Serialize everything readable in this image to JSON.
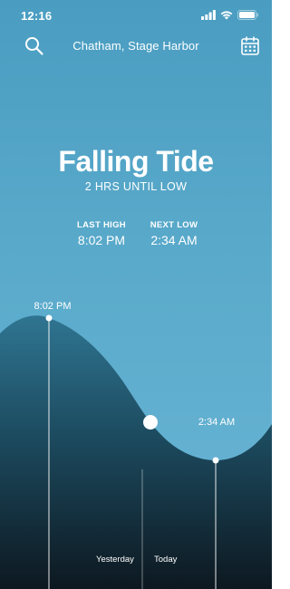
{
  "status_bar": {
    "time": "12:16",
    "icons": [
      "signal-icon",
      "wifi-icon",
      "battery-icon"
    ]
  },
  "header": {
    "location": "Chatham, Stage Harbor",
    "left_icon": "search-icon",
    "right_icon": "calendar-icon"
  },
  "tide": {
    "state": "Falling Tide",
    "countdown": "2 HRS UNTIL LOW",
    "last_high_label": "LAST HIGH",
    "last_high_time": "8:02 PM",
    "next_low_label": "NEXT LOW",
    "next_low_time": "2:34 AM"
  },
  "chart_markers": {
    "high_time": "8:02 PM",
    "low_time": "2:34 AM"
  },
  "days": {
    "yesterday": "Yesterday",
    "today": "Today"
  },
  "colors": {
    "sky_top": "#4a9dc1",
    "sky_bottom": "#6ab5d6",
    "water_top": "#2f7591",
    "water_bottom": "#0d1820"
  }
}
